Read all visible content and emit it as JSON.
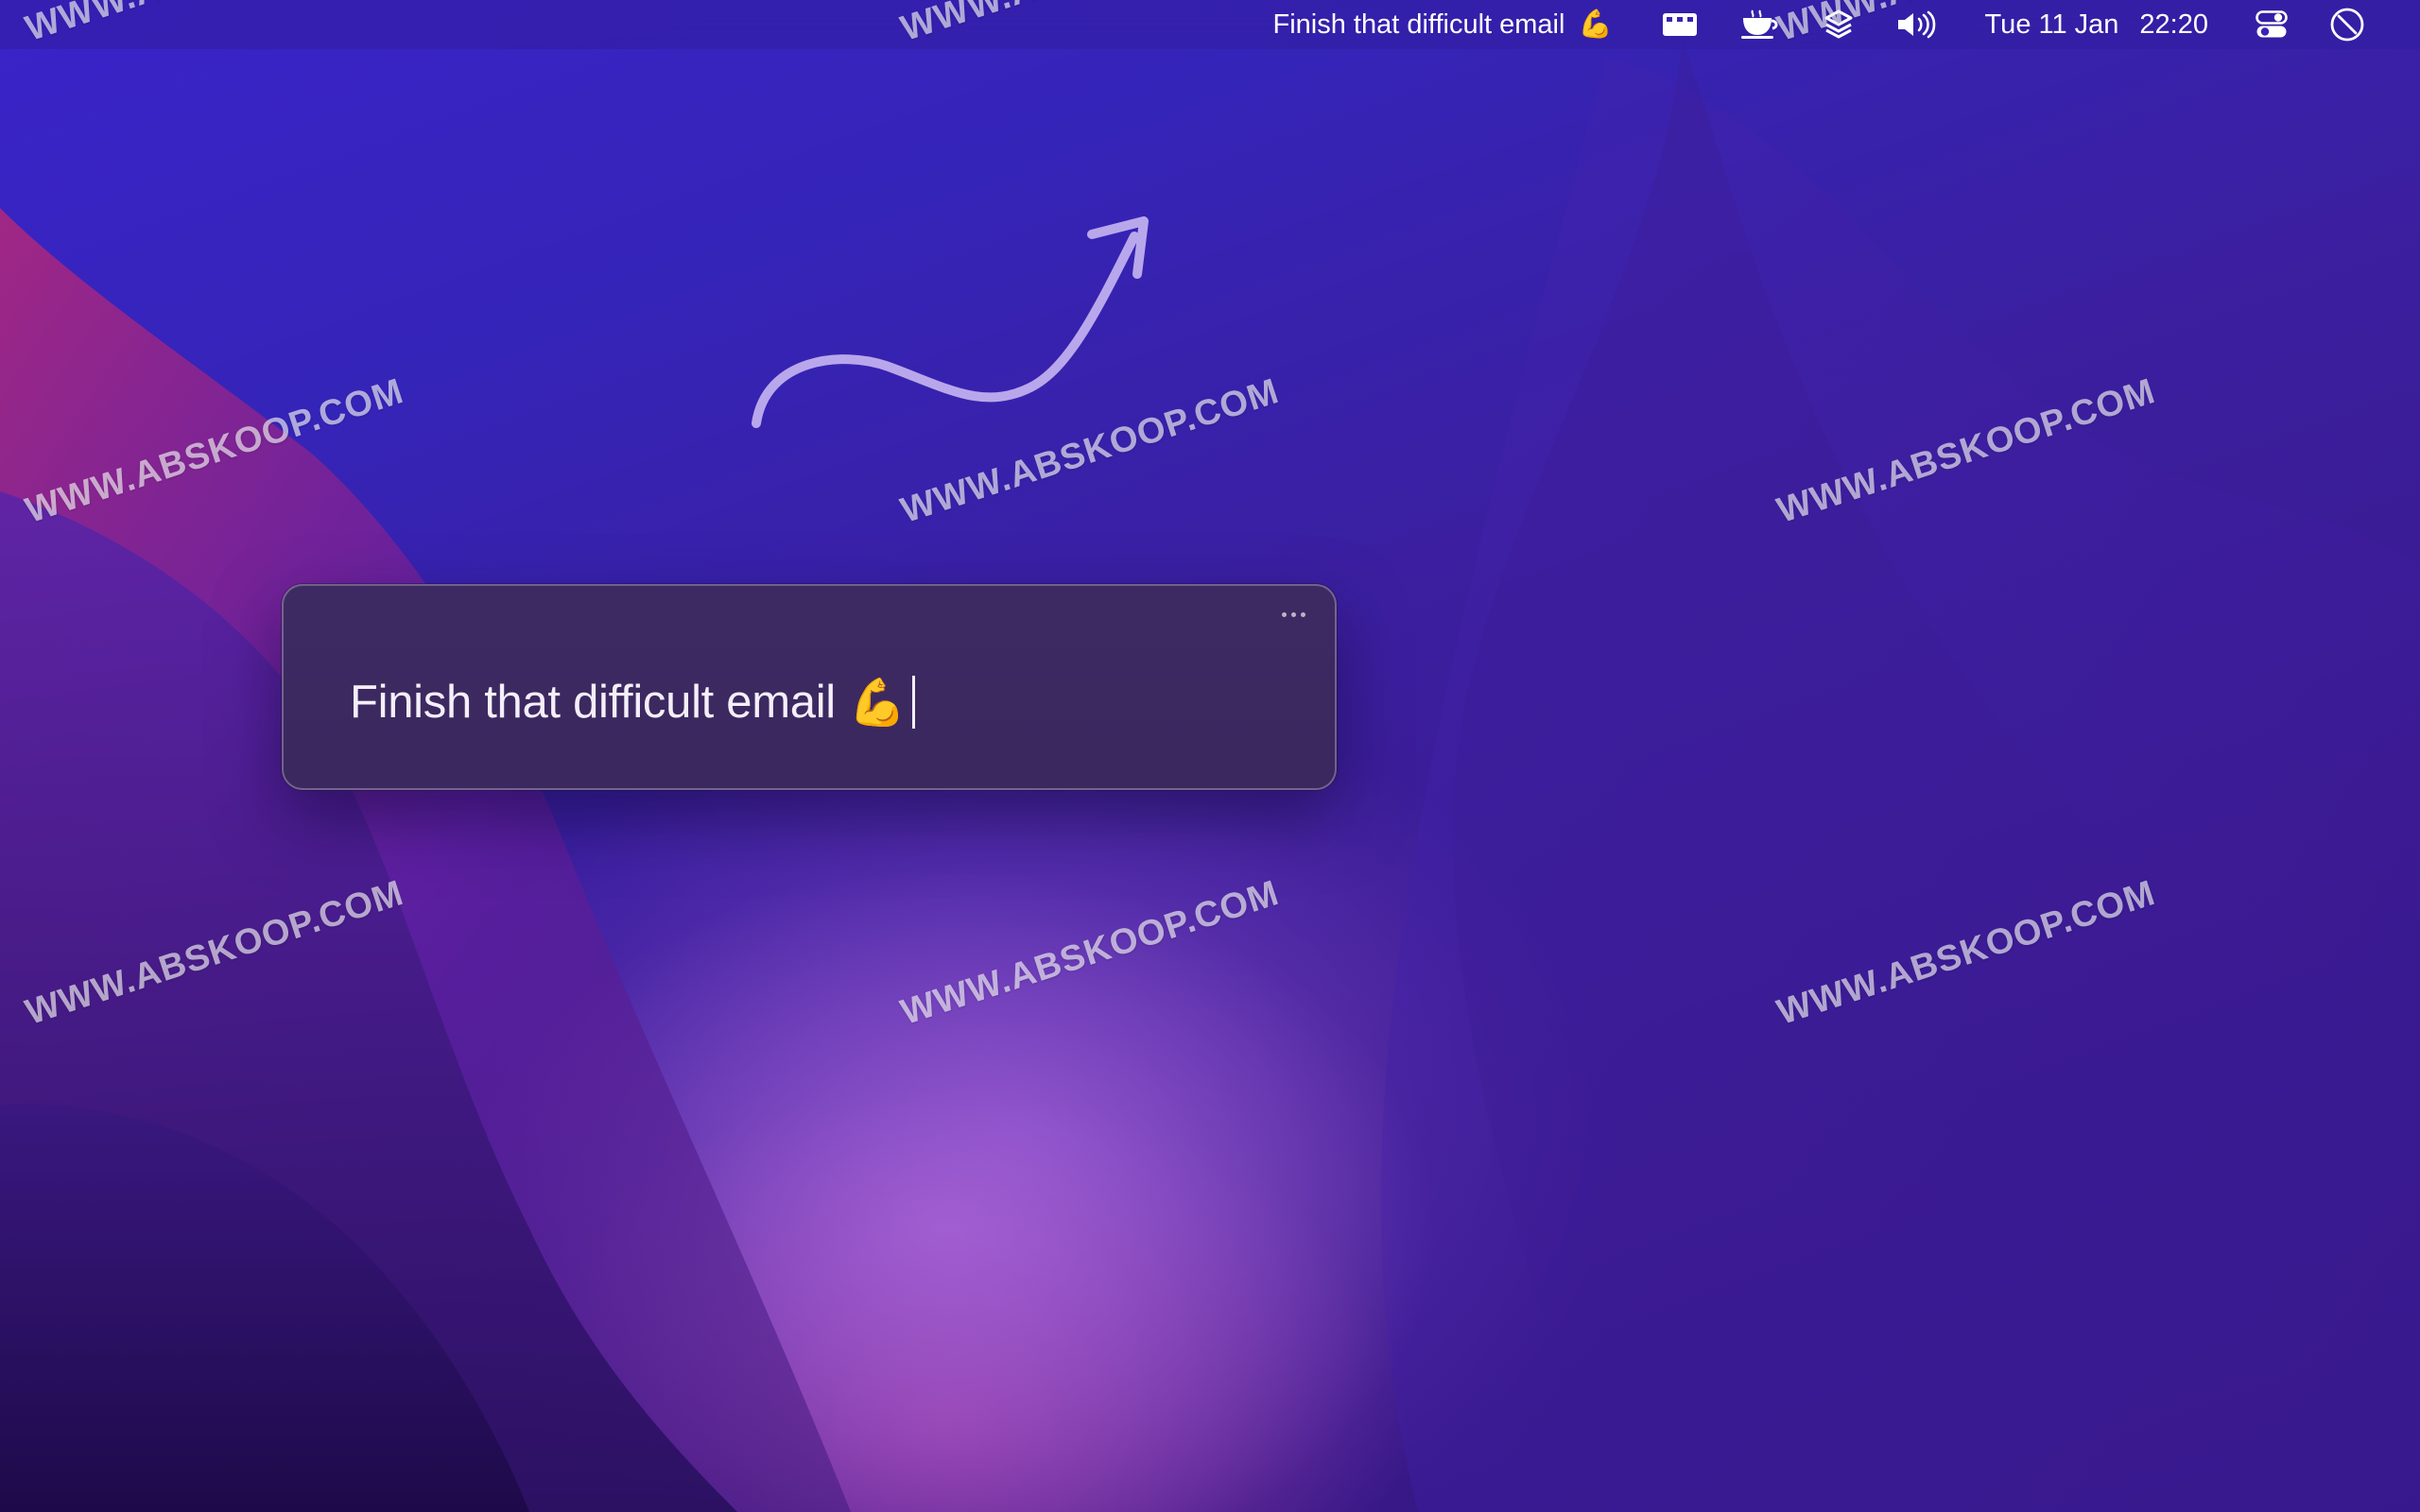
{
  "menubar": {
    "task_title": "Finish that difficult email",
    "task_emoji": "💪",
    "icons": [
      "screen-icon",
      "coffee-cup-icon",
      "layers-icon",
      "volume-icon",
      "control-center-icon",
      "focus-timer-icon"
    ],
    "clock_day": "Tue 11 Jan",
    "clock_time": "22:20"
  },
  "popup": {
    "input_value": "Finish that difficult email",
    "input_emoji": "💪",
    "menu_icon": "ellipsis-icon"
  },
  "watermark": {
    "text": "WWW.ABSKOOP.COM"
  },
  "colors": {
    "wallpaper_top": "#3a23c9",
    "wallpaper_bottom": "#33157e",
    "popup_bg": "#3c2960",
    "arrow": "#b9a7ec"
  }
}
